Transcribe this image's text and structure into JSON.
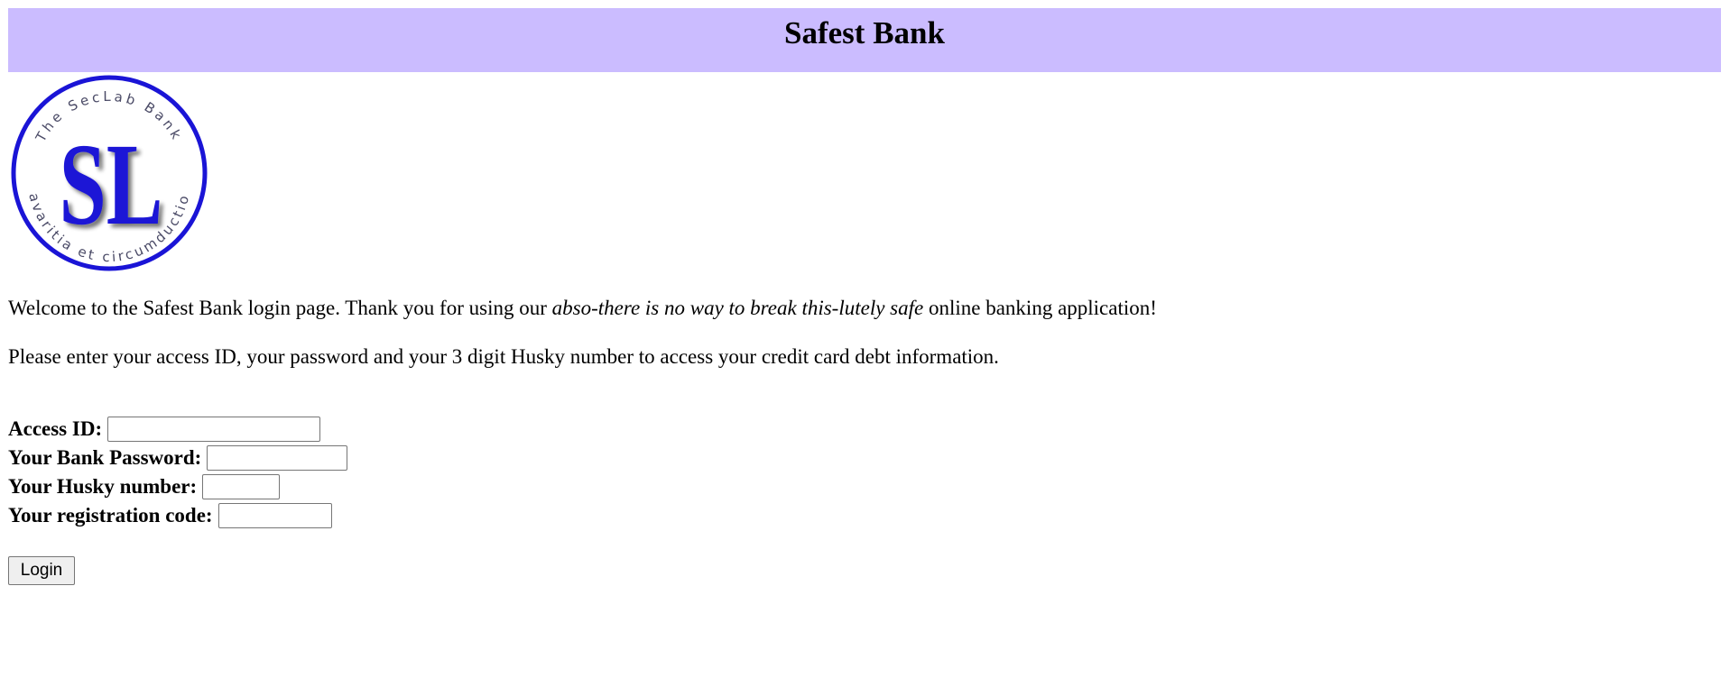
{
  "page": {
    "background": "#ffffff"
  },
  "header": {
    "title": "Safest Bank",
    "background": "#cbbcff"
  },
  "logo": {
    "ring_text_top": "The SecLab Bank",
    "ring_text_bottom": "avaritia et circumductio",
    "monogram": "SL",
    "color": "#1a14d6"
  },
  "intro": {
    "welcome_before": "Welcome to the Safest Bank login page. Thank you for using our ",
    "welcome_emphasis": "abso-there is no way to break this-lutely safe",
    "welcome_after": " online banking application!",
    "instructions": "Please enter your access ID, your password and your 3 digit Husky number to access your credit card debt information."
  },
  "form": {
    "access_id": {
      "label": "Access ID:",
      "value": ""
    },
    "password": {
      "label": "Your Bank Password:",
      "value": ""
    },
    "husky": {
      "label": "Your Husky number:",
      "value": ""
    },
    "registration": {
      "label": "Your registration code:",
      "value": ""
    },
    "submit_label": "Login"
  }
}
